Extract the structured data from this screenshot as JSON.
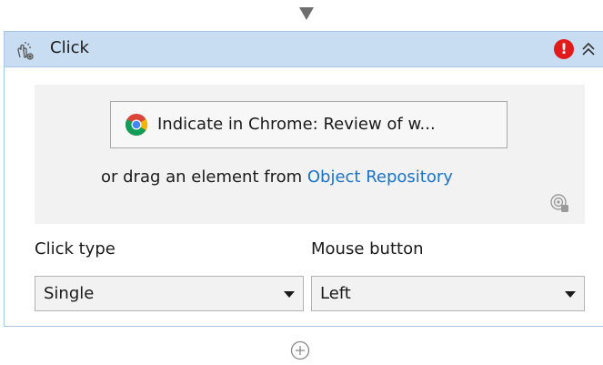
{
  "activity": {
    "title": "Click",
    "icon": "click-activity-icon",
    "error_glyph": "!",
    "collapse_icon": "chevron-double-up-icon"
  },
  "target": {
    "indicate_label": "Indicate in Chrome: Review of w...",
    "indicate_icon": "chrome-icon",
    "drag_prefix": "or drag an element from ",
    "repository_link": "Object Repository",
    "target_icon": "target-icon"
  },
  "properties": {
    "click_type_label": "Click type",
    "click_type_value": "Single",
    "mouse_button_label": "Mouse button",
    "mouse_button_value": "Left"
  },
  "colors": {
    "header_bg": "#c8ddf1",
    "link": "#1a73c8",
    "error": "#e11b1b"
  }
}
